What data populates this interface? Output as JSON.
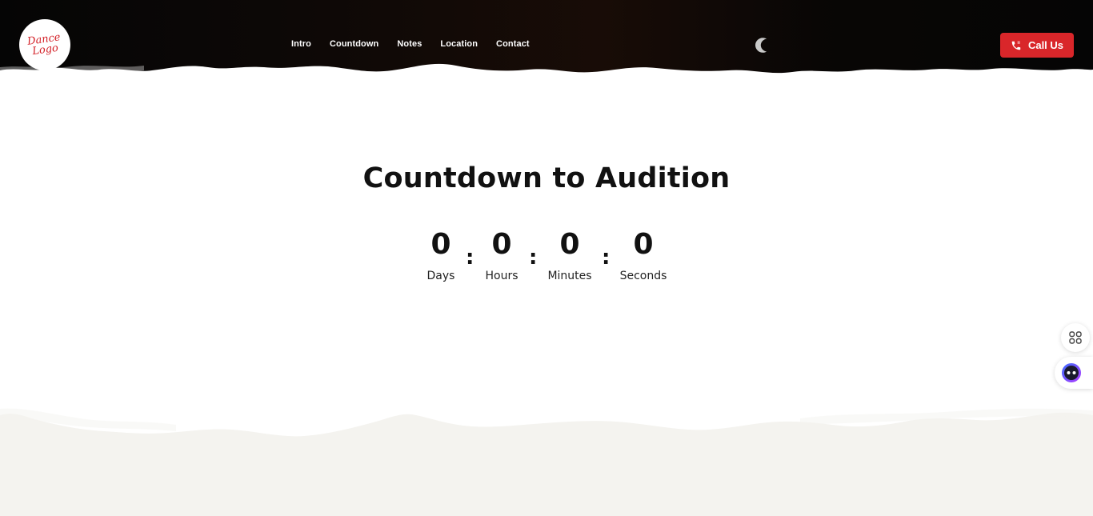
{
  "logo": {
    "line1": "Dance",
    "line2": "Logo"
  },
  "nav": {
    "items": [
      {
        "label": "Intro"
      },
      {
        "label": "Countdown"
      },
      {
        "label": "Notes"
      },
      {
        "label": "Location"
      },
      {
        "label": "Contact"
      }
    ]
  },
  "header": {
    "theme_toggle_icon": "moon-icon",
    "call_button": {
      "label": "Call Us",
      "icon": "phone-icon",
      "color": "#d9262a"
    }
  },
  "countdown": {
    "title": "Countdown to Audition",
    "separator": ":",
    "units": [
      {
        "value": "0",
        "label": "Days"
      },
      {
        "value": "0",
        "label": "Hours"
      },
      {
        "value": "0",
        "label": "Minutes"
      },
      {
        "value": "0",
        "label": "Seconds"
      }
    ]
  },
  "widgets": {
    "apps_icon": "apps-grid-icon",
    "assistant_icon": "assistant-bot-icon"
  },
  "colors": {
    "accent": "#d9262a",
    "header_bg": "#050505",
    "footer_bg": "#f4f3ef"
  }
}
